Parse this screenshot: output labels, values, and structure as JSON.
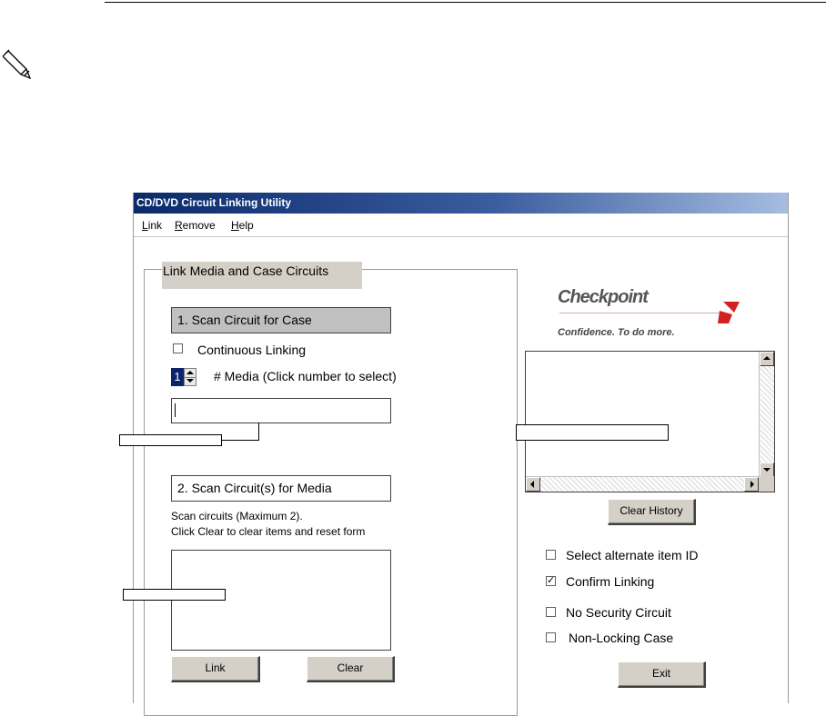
{
  "window": {
    "title": "CD/DVD Circuit Linking Utility"
  },
  "menu": {
    "items": [
      "Link",
      "Remove",
      "Help"
    ]
  },
  "group": {
    "title": "Link Media and Case Circuits"
  },
  "step1": {
    "label": "1. Scan Circuit for Case"
  },
  "continuous": {
    "label": "Continuous Linking",
    "checked": false
  },
  "media_spinner": {
    "value": "1",
    "label": "# Media (Click number to select)"
  },
  "case_input": {
    "value": ""
  },
  "step2": {
    "label": "2. Scan Circuit(s) for Media",
    "hint1": "Scan circuits (Maximum 2).",
    "hint2": "Click Clear to clear items and reset form"
  },
  "buttons": {
    "link": "Link",
    "clear": "Clear",
    "clear_history": "Clear History",
    "exit": "Exit"
  },
  "logo": {
    "wordmark": "Checkpoint",
    "tagline": "Confidence. To do more.",
    "mark_color": "#d42020"
  },
  "options": [
    {
      "label": "Select alternate item ID",
      "checked": false
    },
    {
      "label": "Confirm Linking",
      "checked": true
    },
    {
      "label": "No Security Circuit",
      "checked": false
    },
    {
      "label": "Non-Locking Case",
      "checked": false
    }
  ],
  "colors": {
    "titlebar_start": "#0a2a6a",
    "titlebar_end": "#a6bde0",
    "button_face": "#d4d0c8",
    "step1_box": "#c0c0c0"
  }
}
